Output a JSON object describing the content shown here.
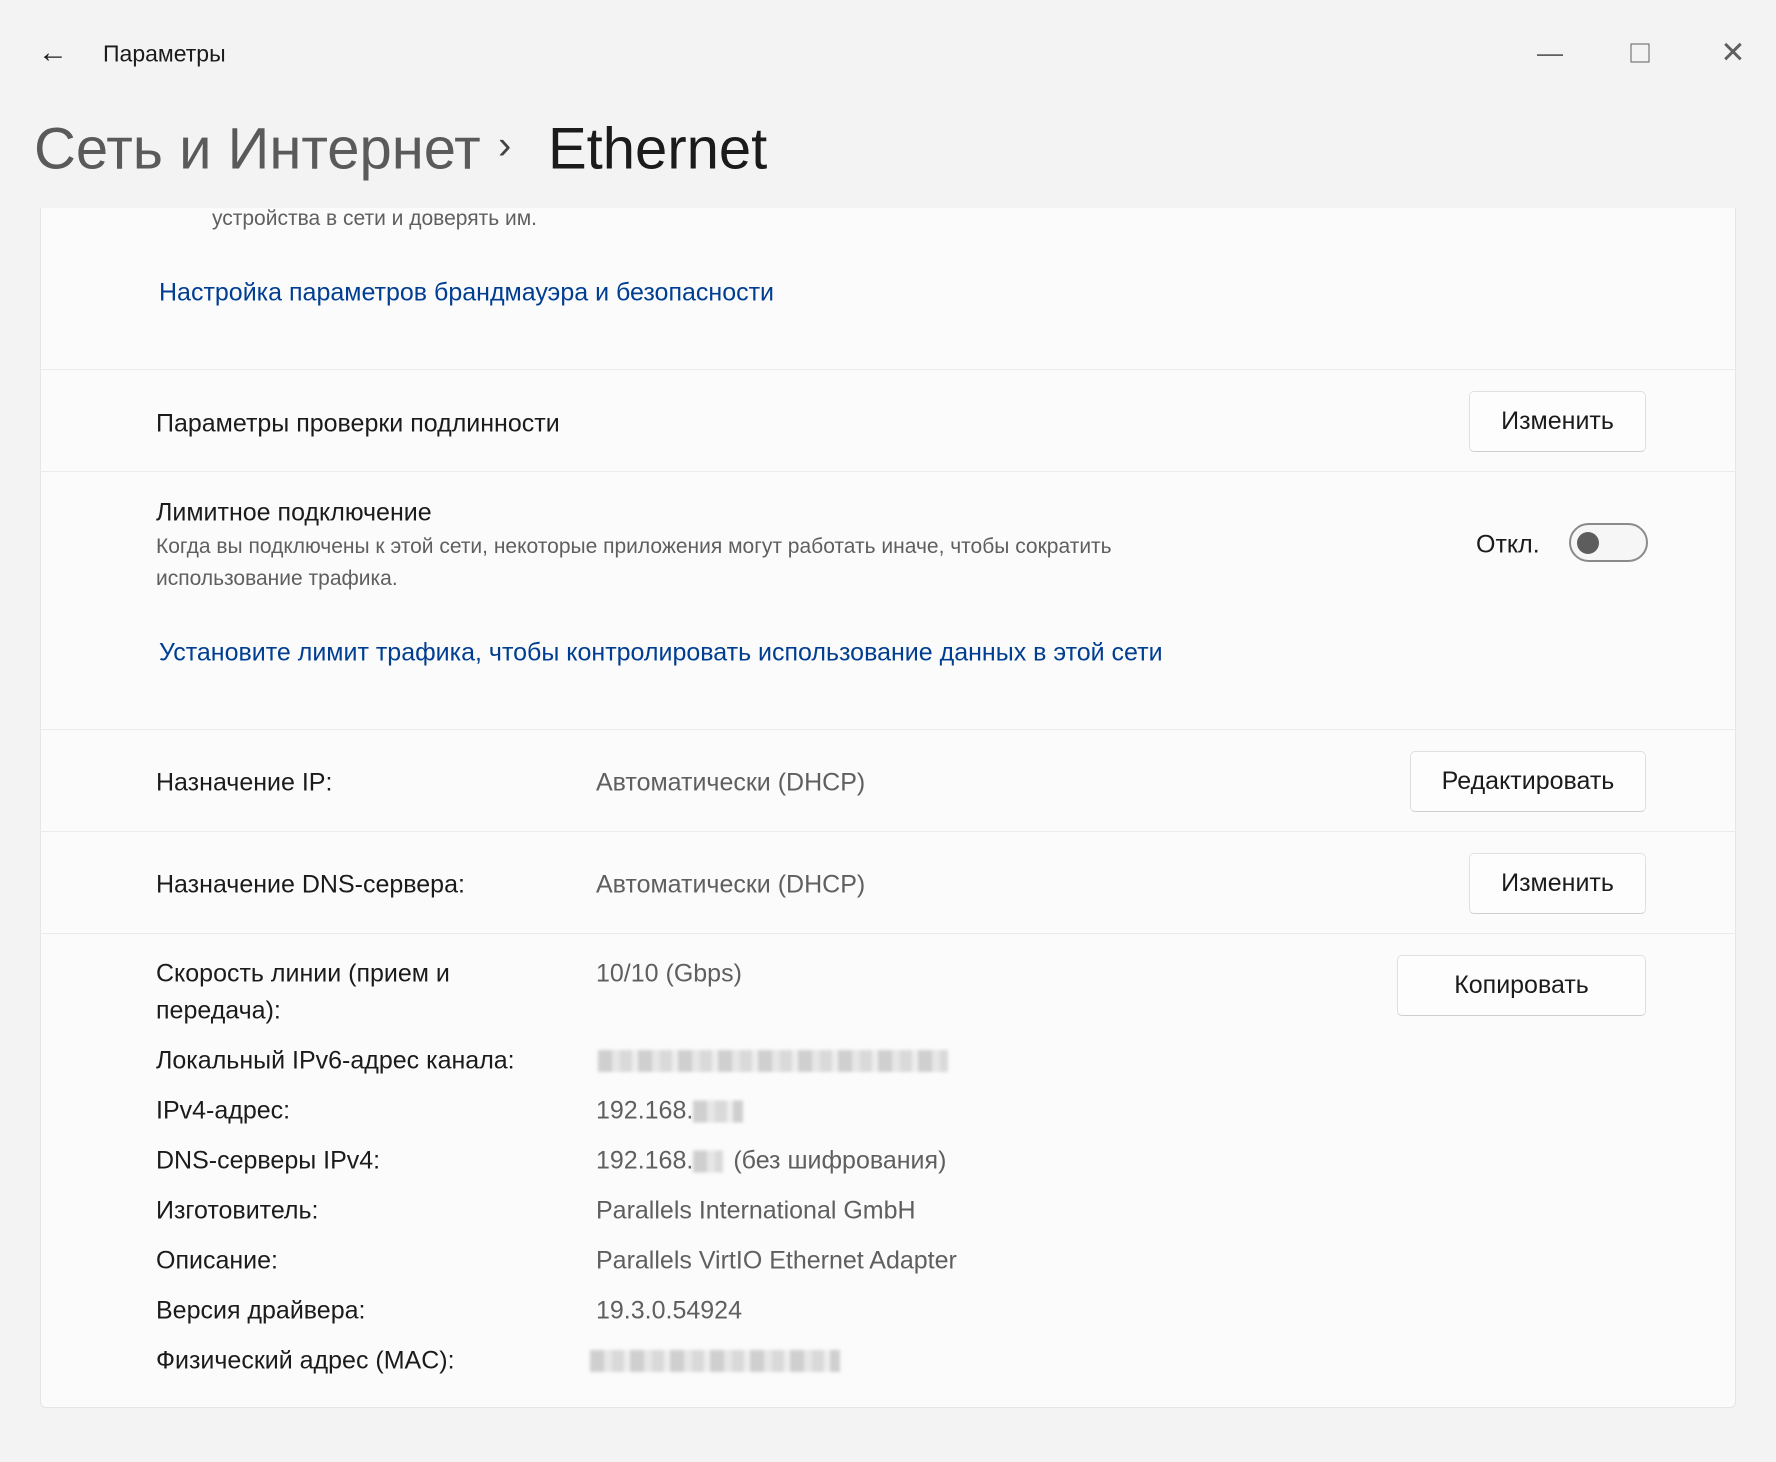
{
  "titlebar": {
    "app_title": "Параметры",
    "back_icon": "arrow-left-icon",
    "controls": [
      "minimize-icon",
      "maximize-icon",
      "close-icon"
    ]
  },
  "breadcrumb": {
    "parent": "Сеть и Интернет",
    "separator": "›",
    "current": "Ethernet"
  },
  "firewall": {
    "desc_tail": "устройства в сети и доверять им.",
    "link": "Настройка параметров брандмауэра и безопасности"
  },
  "auth": {
    "label": "Параметры проверки подлинности",
    "button": "Изменить"
  },
  "metered": {
    "title": "Лимитное подключение",
    "desc_line1": "Когда вы подключены к этой сети, некоторые приложения могут работать иначе, чтобы сократить",
    "desc_line2": "использование трафика.",
    "toggle_label": "Откл.",
    "toggle_on": false,
    "link": "Установите лимит трафика, чтобы контролировать использование данных в этой сети"
  },
  "ip": {
    "label": "Назначение IP:",
    "value": "Автоматически (DHCP)",
    "button": "Редактировать"
  },
  "dns": {
    "label": "Назначение DNS-сервера:",
    "value": "Автоматически (DHCP)",
    "button": "Изменить"
  },
  "props": {
    "copy_button": "Копировать",
    "speed_label_1": "Скорость линии (прием и",
    "speed_label_2": "передача):",
    "speed_value": "10/10 (Gbps)",
    "ipv6_label": "Локальный IPv6-адрес канала:",
    "ipv4_label": "IPv4-адрес:",
    "ipv4_value": "192.168.",
    "dns4_label": "DNS-серверы IPv4:",
    "dns4_value": "192.168.",
    "dns4_suffix": "(без шифрования)",
    "maker_label": "Изготовитель:",
    "maker_value": "Parallels International GmbH",
    "desc_label": "Описание:",
    "desc_value": "Parallels VirtIO Ethernet Adapter",
    "driver_label": "Версия драйвера:",
    "driver_value": "19.3.0.54924",
    "mac_label": "Физический адрес (MAC):"
  },
  "colors": {
    "link": "#003e92",
    "background": "#f3f3f3",
    "card": "#fbfbfb"
  }
}
